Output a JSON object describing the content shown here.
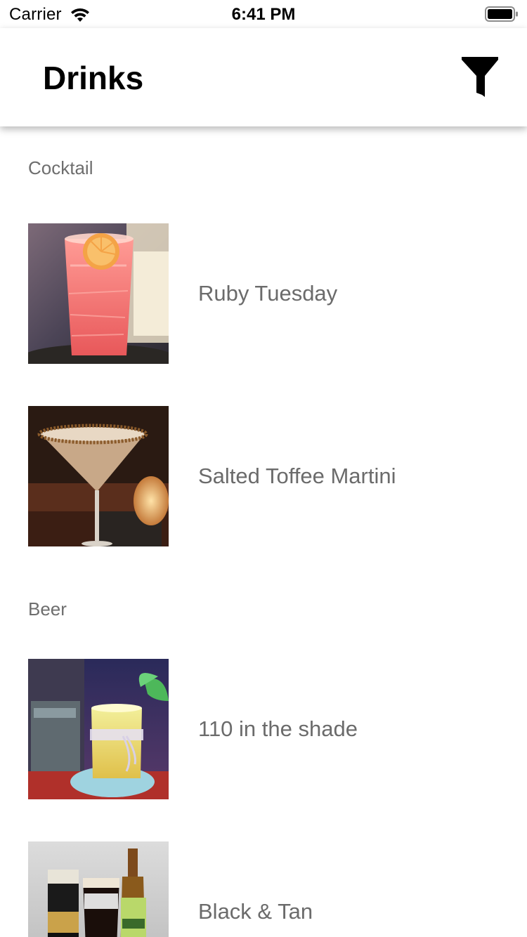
{
  "status_bar": {
    "carrier": "Carrier",
    "time": "6:41 PM",
    "wifi_icon": "wifi-icon",
    "battery_icon": "battery-icon"
  },
  "app_bar": {
    "title": "Drinks",
    "filter_icon": "filter-icon"
  },
  "sections": [
    {
      "title": "Cocktail",
      "items": [
        {
          "name": "Ruby Tuesday",
          "image": "pink iced cocktail with orange slice"
        },
        {
          "name": "Salted Toffee Martini",
          "image": "martini glass with toffee rim"
        }
      ]
    },
    {
      "title": "Beer",
      "items": [
        {
          "name": "110 in the shade",
          "image": "yellow drink with mint"
        },
        {
          "name": "Black & Tan",
          "image": "stout, layered glass and lager bottle"
        }
      ]
    }
  ],
  "colors": {
    "background": "#ffffff",
    "title": "#000000",
    "secondary_text": "#6e6e6e"
  }
}
